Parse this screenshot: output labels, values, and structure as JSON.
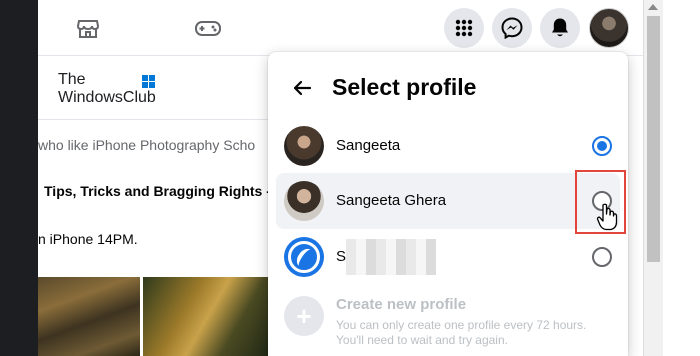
{
  "watermark": {
    "line1": "The",
    "line2": "WindowsClub"
  },
  "feed": {
    "line1": "who like iPhone Photography Scho",
    "line2": "Tips, Tricks and Bragging Rights -",
    "line3": "n iPhone 14PM."
  },
  "top_nav": {
    "icons": [
      "marketplace-icon",
      "gaming-icon",
      "menu-grid-icon",
      "messenger-icon",
      "notifications-bell-icon",
      "account-avatar"
    ]
  },
  "panel": {
    "title": "Select profile",
    "profiles": [
      {
        "name": "Sangeeta",
        "selected": true
      },
      {
        "name": "Sangeeta Ghera",
        "selected": false
      },
      {
        "name": "S",
        "selected": false
      }
    ],
    "create": {
      "title": "Create new profile",
      "subtitle_line1": "You can only create one profile every 72 hours.",
      "subtitle_line2": "You'll need to wait and try again."
    }
  },
  "colors": {
    "accent": "#1b74e4",
    "highlight": "#e2453c",
    "hover_row": "#f0f2f5"
  }
}
